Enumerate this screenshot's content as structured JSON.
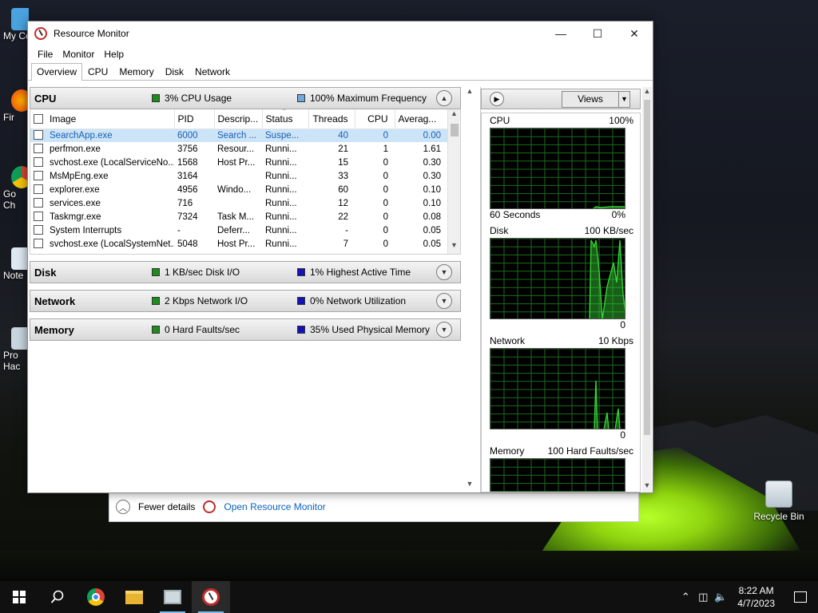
{
  "window": {
    "title": "Resource Monitor",
    "menu": [
      "File",
      "Monitor",
      "Help"
    ],
    "tabs": [
      "Overview",
      "CPU",
      "Memory",
      "Disk",
      "Network"
    ],
    "active_tab": "Overview"
  },
  "cpu": {
    "title": "CPU",
    "stat1": "3% CPU Usage",
    "stat2": "100% Maximum Frequency",
    "columns": [
      "Image",
      "PID",
      "Descrip...",
      "Status",
      "Threads",
      "CPU",
      "Averag..."
    ],
    "rows": [
      {
        "image": "SearchApp.exe",
        "pid": "6000",
        "desc": "Search ...",
        "status": "Suspe...",
        "threads": "40",
        "cpu": "0",
        "avg": "0.00"
      },
      {
        "image": "perfmon.exe",
        "pid": "3756",
        "desc": "Resour...",
        "status": "Runni...",
        "threads": "21",
        "cpu": "1",
        "avg": "1.61"
      },
      {
        "image": "svchost.exe (LocalServiceNo...",
        "pid": "1568",
        "desc": "Host Pr...",
        "status": "Runni...",
        "threads": "15",
        "cpu": "0",
        "avg": "0.30"
      },
      {
        "image": "MsMpEng.exe",
        "pid": "3164",
        "desc": "",
        "status": "Runni...",
        "threads": "33",
        "cpu": "0",
        "avg": "0.30"
      },
      {
        "image": "explorer.exe",
        "pid": "4956",
        "desc": "Windo...",
        "status": "Runni...",
        "threads": "60",
        "cpu": "0",
        "avg": "0.10"
      },
      {
        "image": "services.exe",
        "pid": "716",
        "desc": "",
        "status": "Runni...",
        "threads": "12",
        "cpu": "0",
        "avg": "0.10"
      },
      {
        "image": "Taskmgr.exe",
        "pid": "7324",
        "desc": "Task M...",
        "status": "Runni...",
        "threads": "22",
        "cpu": "0",
        "avg": "0.08"
      },
      {
        "image": "System Interrupts",
        "pid": "-",
        "desc": "Deferr...",
        "status": "Runni...",
        "threads": "-",
        "cpu": "0",
        "avg": "0.05"
      },
      {
        "image": "svchost.exe (LocalSystemNet...",
        "pid": "5048",
        "desc": "Host Pr...",
        "status": "Runni...",
        "threads": "7",
        "cpu": "0",
        "avg": "0.05"
      }
    ]
  },
  "disk": {
    "title": "Disk",
    "stat1": "1 KB/sec Disk I/O",
    "stat2": "1% Highest Active Time"
  },
  "network": {
    "title": "Network",
    "stat1": "2 Kbps Network I/O",
    "stat2": "0% Network Utilization"
  },
  "memory": {
    "title": "Memory",
    "stat1": "0 Hard Faults/sec",
    "stat2": "35% Used Physical Memory"
  },
  "right_panel": {
    "views_label": "Views",
    "graphs": [
      {
        "name": "CPU",
        "max": "100%",
        "foot_left": "60 Seconds",
        "foot_right": "0%"
      },
      {
        "name": "Disk",
        "max": "100 KB/sec",
        "foot_left": "",
        "foot_right": "0"
      },
      {
        "name": "Network",
        "max": "10 Kbps",
        "foot_left": "",
        "foot_right": "0"
      },
      {
        "name": "Memory",
        "max": "100 Hard Faults/sec",
        "foot_left": "",
        "foot_right": ""
      }
    ]
  },
  "task_manager_footer": {
    "fewer_details": "Fewer details",
    "open_rm": "Open Resource Monitor"
  },
  "desktop": {
    "recycle_bin": "Recycle Bin",
    "left_labels": [
      "My Co",
      "Fir",
      "Go\nCh",
      "Note",
      "Pro\nHac"
    ]
  },
  "taskbar": {
    "time": "8:22 AM",
    "date": "4/7/2023"
  },
  "colors": {
    "graph_line": "#35d235",
    "graph_grid": "#1d6b1d",
    "selection": "#cce4f7",
    "link": "#0b63c4"
  }
}
